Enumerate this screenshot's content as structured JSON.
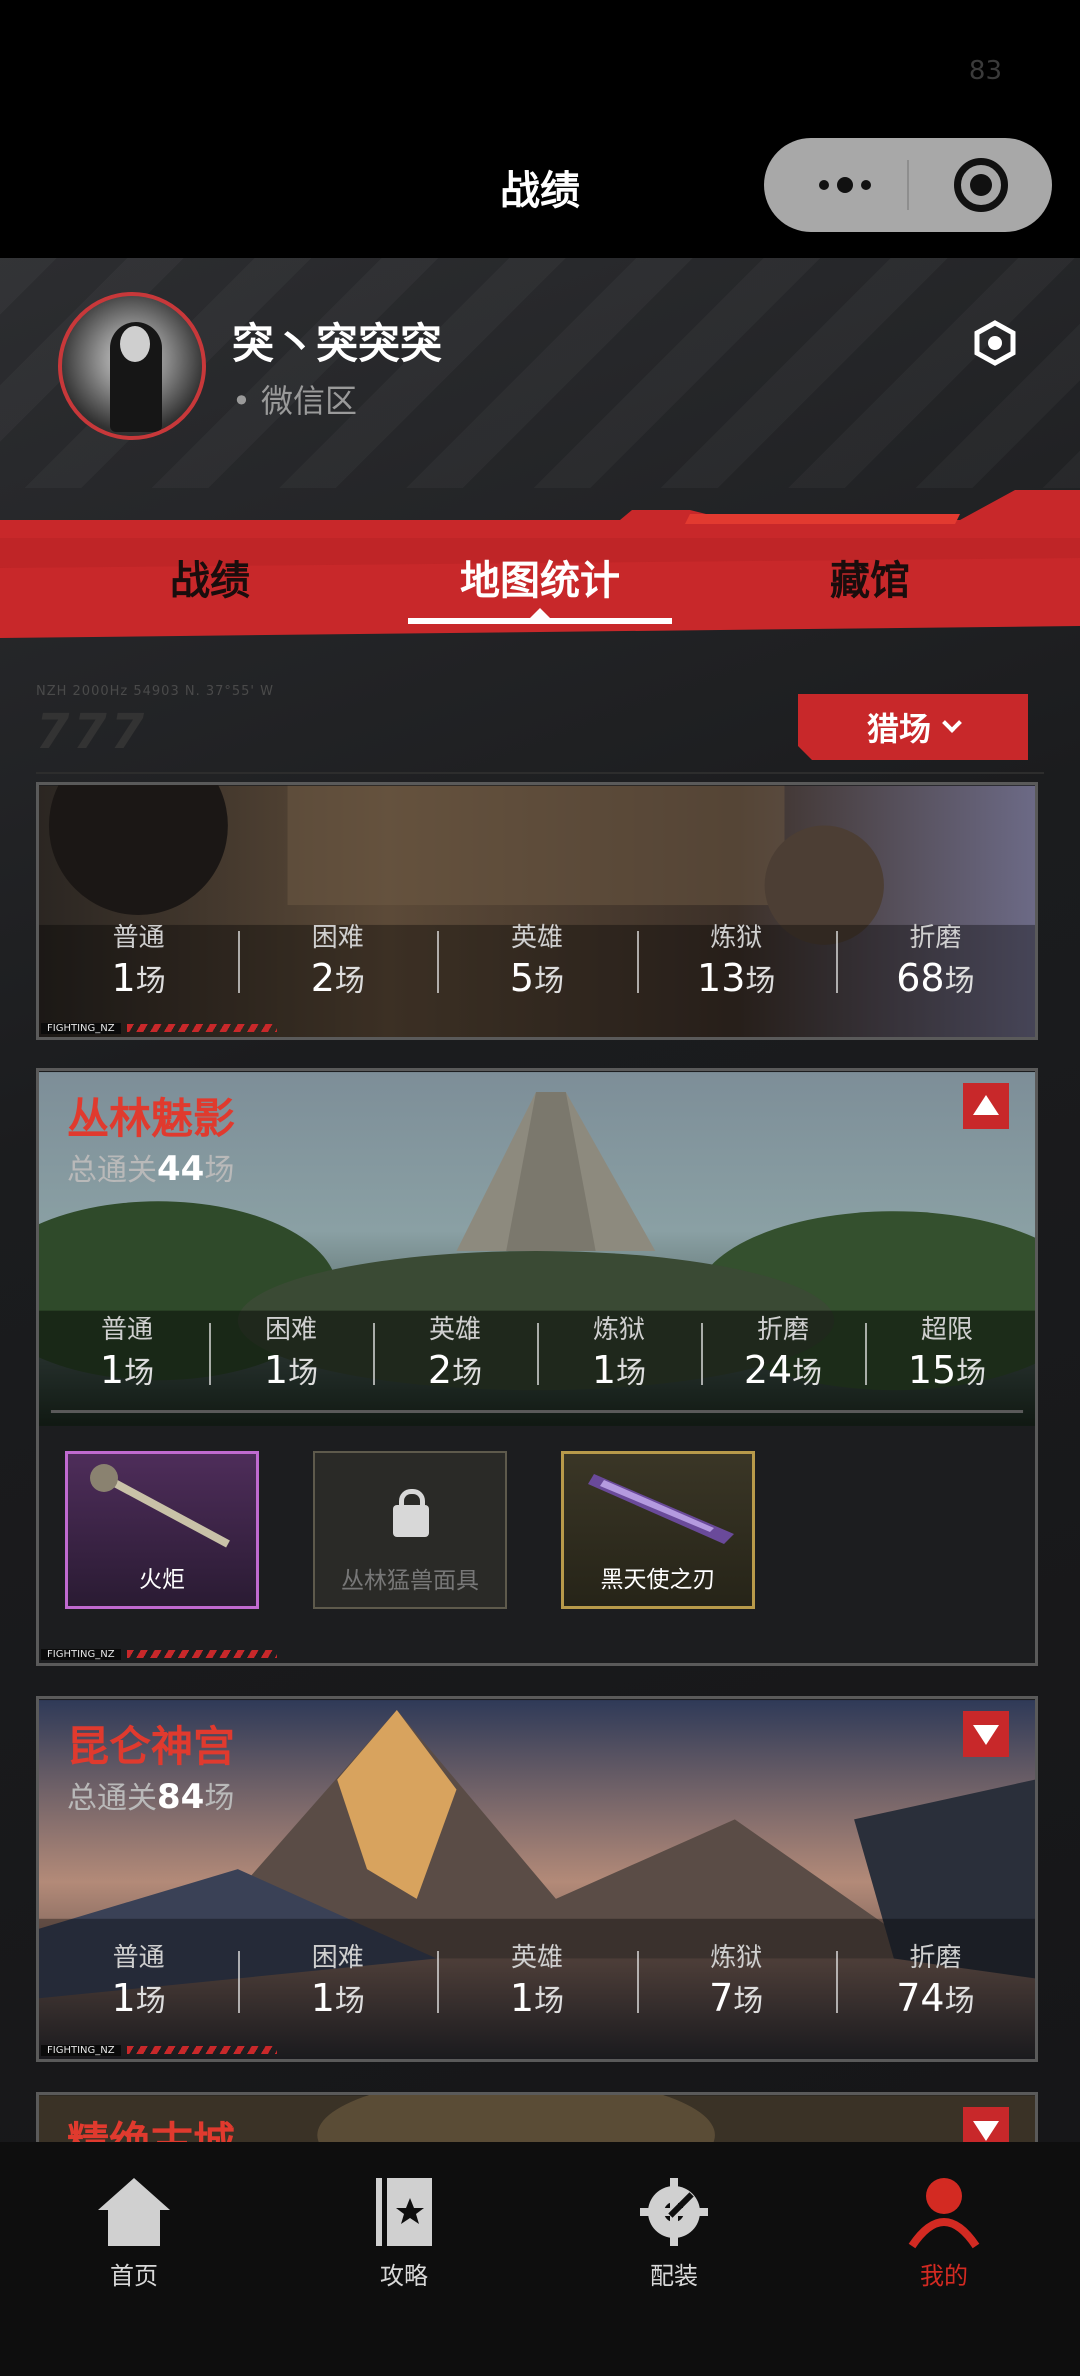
{
  "status": {
    "indicator": "83"
  },
  "header": {
    "title": "战绩"
  },
  "profile": {
    "name": "突丶突突突",
    "server": "• 微信区"
  },
  "tabs": [
    {
      "label": "战绩",
      "active": false
    },
    {
      "label": "地图统计",
      "active": true
    },
    {
      "label": "藏馆",
      "active": false
    }
  ],
  "filter": {
    "selected": "猎场",
    "deco_code": "NZH 2000Hz 54903 N. 37°55' W",
    "deco_num": "777"
  },
  "colors": {
    "accent": "#c8282a",
    "title_red": "#e03a2e",
    "bg": "#1c1d1f"
  },
  "cards": [
    {
      "title": "",
      "expanded": false,
      "stats": [
        {
          "label": "普通",
          "value": "1",
          "unit": "场"
        },
        {
          "label": "困难",
          "value": "2",
          "unit": "场"
        },
        {
          "label": "英雄",
          "value": "5",
          "unit": "场"
        },
        {
          "label": "炼狱",
          "value": "13",
          "unit": "场"
        },
        {
          "label": "折磨",
          "value": "68",
          "unit": "场"
        }
      ],
      "tag": "FIGHTING_NZ"
    },
    {
      "title": "丛林魅影",
      "total_prefix": "总通关",
      "total": "44",
      "total_unit": "场",
      "expanded": true,
      "stats": [
        {
          "label": "普通",
          "value": "1",
          "unit": "场"
        },
        {
          "label": "困难",
          "value": "1",
          "unit": "场"
        },
        {
          "label": "英雄",
          "value": "2",
          "unit": "场"
        },
        {
          "label": "炼狱",
          "value": "1",
          "unit": "场"
        },
        {
          "label": "折磨",
          "value": "24",
          "unit": "场"
        },
        {
          "label": "超限",
          "value": "15",
          "unit": "场"
        }
      ],
      "rewards": [
        {
          "name": "火炬",
          "rarity": "purple",
          "locked": false
        },
        {
          "name": "丛林猛兽面具",
          "rarity": "none",
          "locked": true
        },
        {
          "name": "黑天使之刃",
          "rarity": "gold",
          "locked": false
        }
      ],
      "tag": "FIGHTING_NZ"
    },
    {
      "title": "昆仑神宫",
      "total_prefix": "总通关",
      "total": "84",
      "total_unit": "场",
      "expanded": false,
      "stats": [
        {
          "label": "普通",
          "value": "1",
          "unit": "场"
        },
        {
          "label": "困难",
          "value": "1",
          "unit": "场"
        },
        {
          "label": "英雄",
          "value": "1",
          "unit": "场"
        },
        {
          "label": "炼狱",
          "value": "7",
          "unit": "场"
        },
        {
          "label": "折磨",
          "value": "74",
          "unit": "场"
        }
      ],
      "tag": "FIGHTING_NZ"
    },
    {
      "title": "精绝古城",
      "expanded": false
    }
  ],
  "bottom_nav": [
    {
      "label": "首页",
      "icon": "home-icon",
      "active": false
    },
    {
      "label": "攻略",
      "icon": "guide-book-icon",
      "active": false
    },
    {
      "label": "配装",
      "icon": "gear-wrench-icon",
      "active": false
    },
    {
      "label": "我的",
      "icon": "user-icon",
      "active": true
    }
  ]
}
